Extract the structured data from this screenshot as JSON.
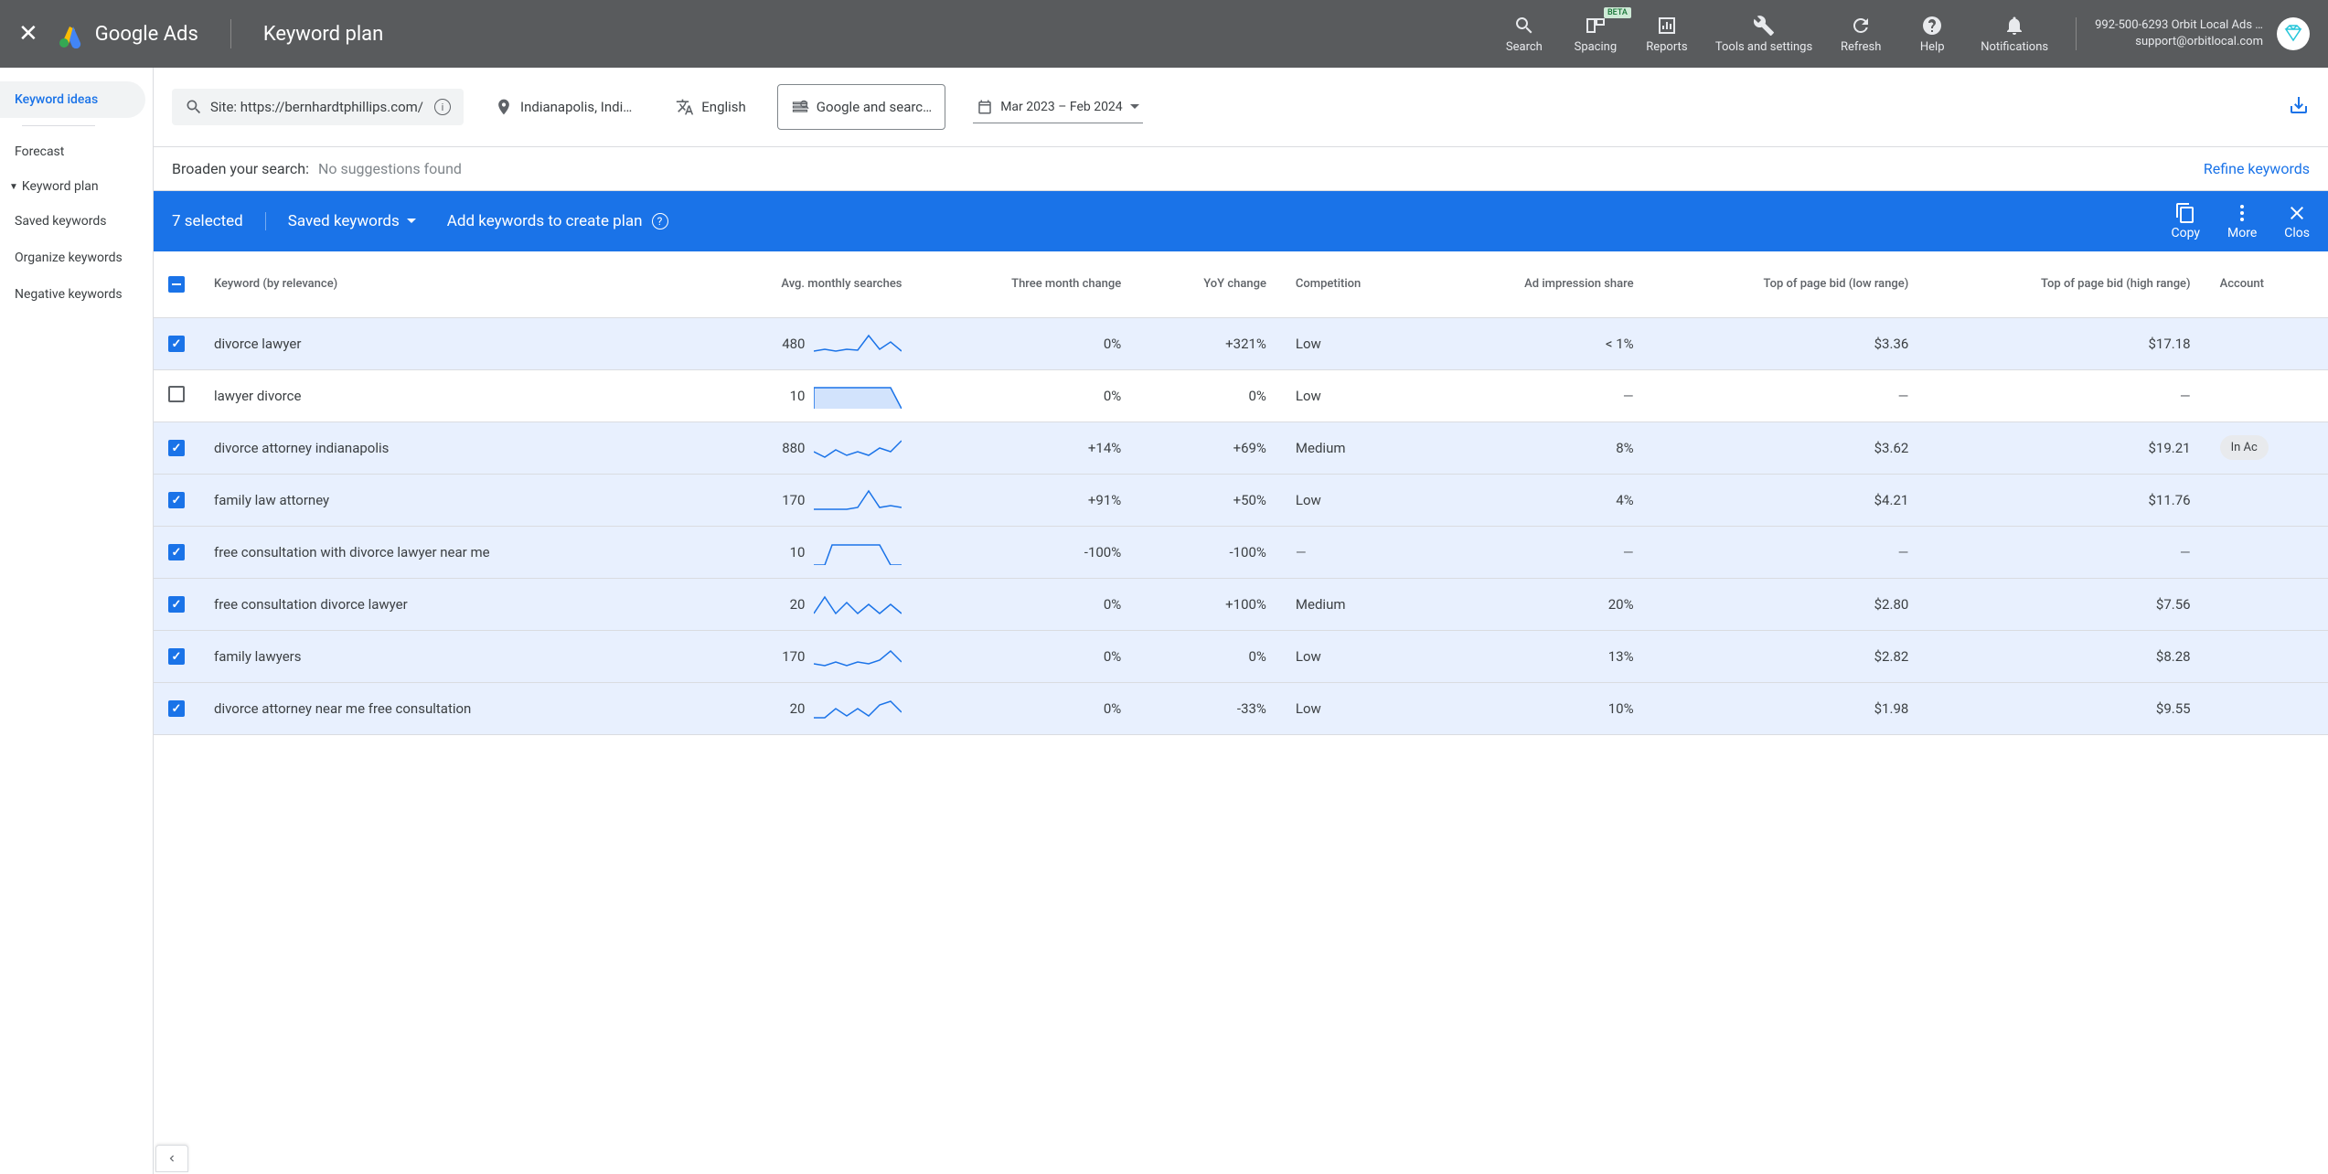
{
  "header": {
    "logo_text": "Google Ads",
    "page_title": "Keyword plan",
    "nav": {
      "search": "Search",
      "spacing": "Spacing",
      "reports": "Reports",
      "tools": "Tools and settings",
      "refresh": "Refresh",
      "help": "Help",
      "notifications": "Notifications"
    },
    "beta": "BETA",
    "account_line1": "992-500-6293 Orbit Local Ads …",
    "account_line2": "support@orbitlocal.com"
  },
  "sidebar": {
    "keyword_ideas": "Keyword ideas",
    "forecast": "Forecast",
    "keyword_plan": "Keyword plan",
    "saved_keywords": "Saved keywords",
    "organize_keywords": "Organize keywords",
    "negative_keywords": "Negative keywords"
  },
  "filters": {
    "site_label": "Site: https://bernhardtphillips.com/",
    "location": "Indianapolis, Indi…",
    "language": "English",
    "networks": "Google and searc…",
    "date_range": "Mar 2023 – Feb 2024"
  },
  "broaden": {
    "label": "Broaden your search:",
    "none": "No suggestions found",
    "refine": "Refine keywords"
  },
  "selection": {
    "count": "7 selected",
    "saved_dropdown": "Saved keywords",
    "add_label": "Add keywords to create plan",
    "copy": "Copy",
    "more": "More",
    "close": "Clos"
  },
  "columns": {
    "keyword": "Keyword (by relevance)",
    "searches": "Avg. monthly searches",
    "three_month": "Three month change",
    "yoy": "YoY change",
    "competition": "Competition",
    "impression": "Ad impression share",
    "bid_low": "Top of page bid (low range)",
    "bid_high": "Top of page bid (high range)",
    "account": "Account"
  },
  "rows": [
    {
      "checked": true,
      "keyword": "divorce lawyer",
      "searches": "480",
      "three_month": "0%",
      "yoy": "+321%",
      "competition": "Low",
      "impression": "< 1%",
      "bid_low": "$3.36",
      "bid_high": "$17.18",
      "account": "",
      "spark": "0,22 12,20 24,22 36,20 48,21 60,5 72,20 84,12 96,22"
    },
    {
      "checked": false,
      "keyword": "lawyer divorce",
      "searches": "10",
      "three_month": "0%",
      "yoy": "0%",
      "competition": "Low",
      "impression": "—",
      "bid_low": "—",
      "bid_high": "—",
      "account": "",
      "spark_fill": true,
      "spark": "0,28 0,5 84,5 96,28 96,28"
    },
    {
      "checked": true,
      "keyword": "divorce attorney indianapolis",
      "searches": "880",
      "three_month": "+14%",
      "yoy": "+69%",
      "competition": "Medium",
      "impression": "8%",
      "bid_low": "$3.62",
      "bid_high": "$19.21",
      "account": "In Ac",
      "spark": "0,18 12,24 24,16 36,22 48,18 60,22 72,14 84,18 96,6"
    },
    {
      "checked": true,
      "keyword": "family law attorney",
      "searches": "170",
      "three_month": "+91%",
      "yoy": "+50%",
      "competition": "Low",
      "impression": "4%",
      "bid_low": "$4.21",
      "bid_high": "$11.76",
      "account": "",
      "spark": "0,24 12,24 24,24 36,24 48,22 60,4 72,22 84,20 96,22"
    },
    {
      "checked": true,
      "keyword": "free consultation with divorce lawyer near me",
      "searches": "10",
      "three_month": "-100%",
      "yoy": "-100%",
      "competition": "—",
      "impression": "—",
      "bid_low": "—",
      "bid_high": "—",
      "account": "",
      "spark": "0,28 12,28 20,6 72,6 84,28 96,28"
    },
    {
      "checked": true,
      "keyword": "free consultation divorce lawyer",
      "searches": "20",
      "three_month": "0%",
      "yoy": "+100%",
      "competition": "Medium",
      "impression": "20%",
      "bid_low": "$2.80",
      "bid_high": "$7.56",
      "account": "",
      "spark": "0,24 12,6 24,24 36,12 48,24 60,14 72,24 84,14 96,24"
    },
    {
      "checked": true,
      "keyword": "family lawyers",
      "searches": "170",
      "three_month": "0%",
      "yoy": "0%",
      "competition": "Low",
      "impression": "13%",
      "bid_low": "$2.82",
      "bid_high": "$8.28",
      "account": "",
      "spark": "0,22 12,24 24,20 36,24 48,20 60,22 72,18 84,8 96,20"
    },
    {
      "checked": true,
      "keyword": "divorce attorney near me free consultation",
      "searches": "20",
      "three_month": "0%",
      "yoy": "-33%",
      "competition": "Low",
      "impression": "10%",
      "bid_low": "$1.98",
      "bid_high": "$9.55",
      "account": "",
      "spark": "0,24 12,24 24,14 36,22 48,14 60,22 72,10 84,6 96,18"
    }
  ]
}
